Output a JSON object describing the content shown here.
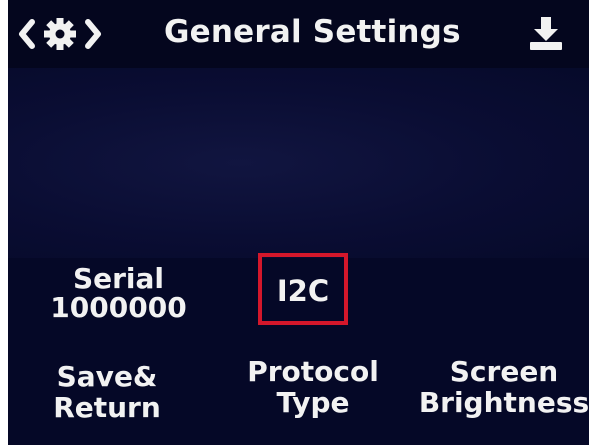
{
  "header": {
    "title": "General Settings",
    "nav_icon": "settings-nav-icon",
    "download_icon": "download-icon"
  },
  "values": {
    "serial_label": "Serial",
    "serial_baud": "1000000",
    "protocol_value": "I2C"
  },
  "softkeys": {
    "save_line1": "Save&",
    "save_line2": "Return",
    "protocol_line1": "Protocol",
    "protocol_line2": "Type",
    "brightness_line1": "Screen",
    "brightness_line2": "Brightness"
  },
  "colors": {
    "screen_bg": "#050827",
    "text": "#f2f2f2",
    "selection_border": "#d4172b"
  }
}
